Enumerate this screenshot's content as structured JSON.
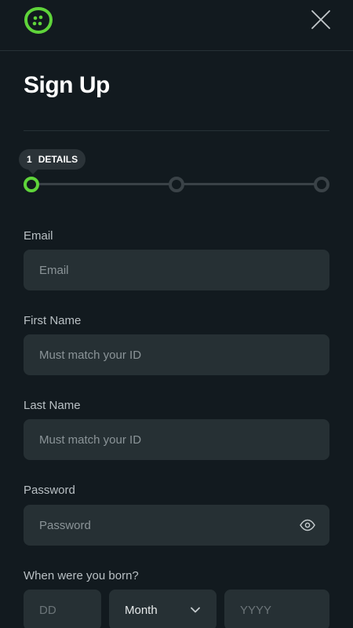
{
  "header": {
    "logo_icon": "cookie-logo-icon",
    "close_icon": "close-icon"
  },
  "title": "Sign Up",
  "stepper": {
    "current_number": "1",
    "current_label": "DETAILS",
    "steps_total": 3,
    "active_color": "#5fd43a"
  },
  "form": {
    "email": {
      "label": "Email",
      "placeholder": "Email"
    },
    "first_name": {
      "label": "First Name",
      "placeholder": "Must match your ID"
    },
    "last_name": {
      "label": "Last Name",
      "placeholder": "Must match your ID"
    },
    "password": {
      "label": "Password",
      "placeholder": "Password",
      "toggle_icon": "eye-icon"
    },
    "dob": {
      "label": "When were you born?",
      "day_placeholder": "DD",
      "month_value": "Month",
      "year_placeholder": "YYYY"
    }
  }
}
